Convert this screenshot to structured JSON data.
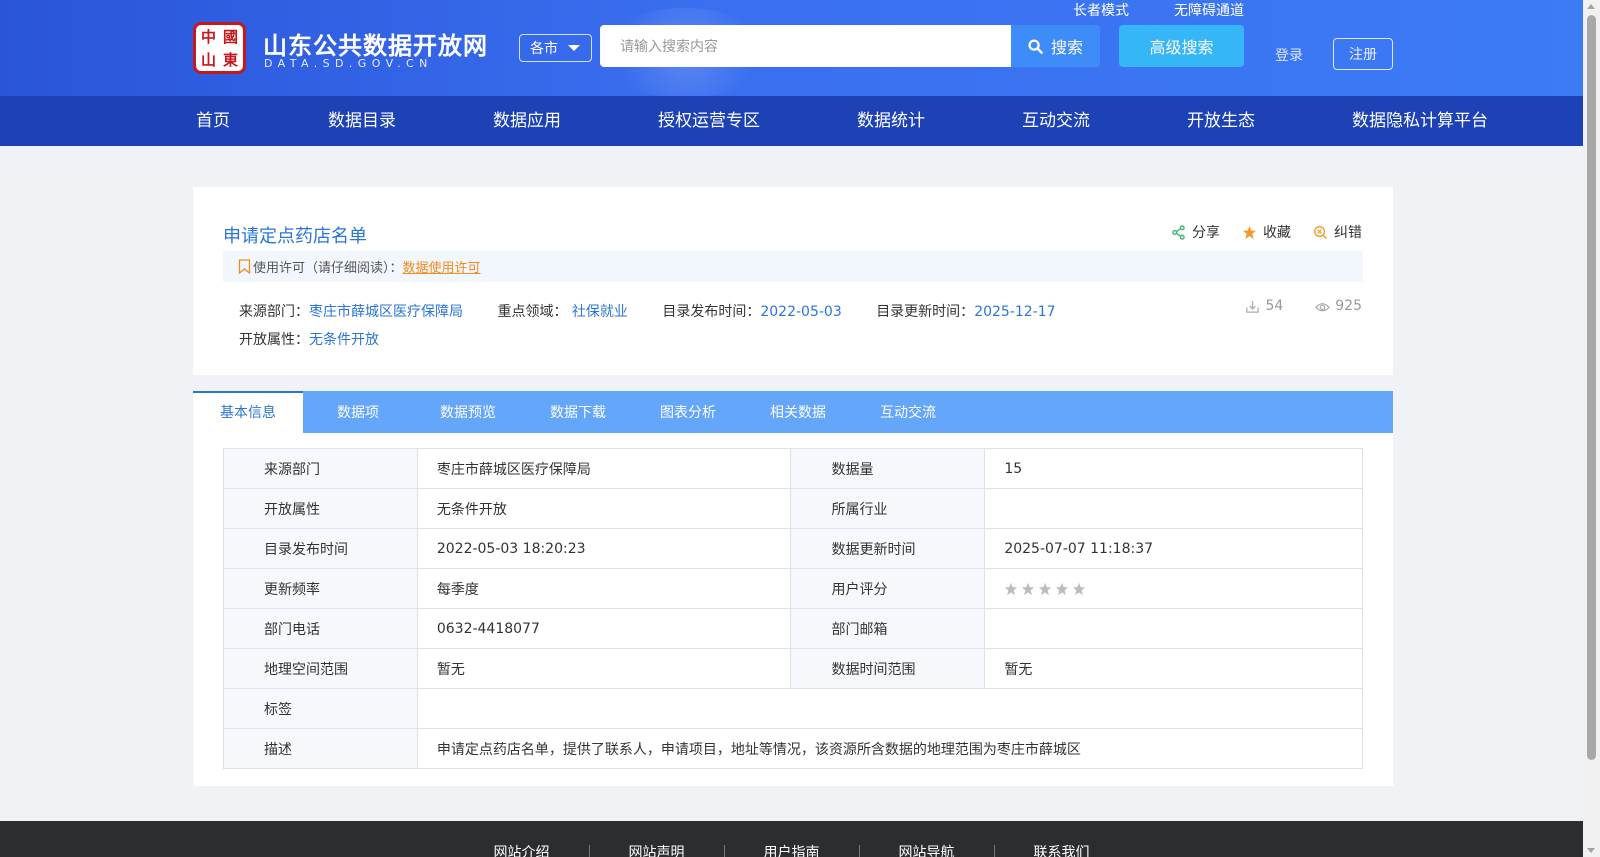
{
  "header": {
    "logo_chars": [
      "中",
      "國",
      "山",
      "東"
    ],
    "site_title": "山东公共数据开放网",
    "site_domain": "DATA.SD.GOV.CN",
    "city_select": "各市",
    "elder_mode": "长者模式",
    "accessibility": "无障碍通道",
    "search_placeholder": "请输入搜索内容",
    "search_label": "搜索",
    "advanced_search_label": "高级搜索",
    "login_label": "登录",
    "register_label": "注册"
  },
  "nav": {
    "items": [
      "首页",
      "数据目录",
      "数据应用",
      "授权运营专区",
      "数据统计",
      "互动交流",
      "开放生态",
      "数据隐私计算平台"
    ]
  },
  "dataset": {
    "title": "申请定点药店名单",
    "actions": {
      "share": "分享",
      "favorite": "收藏",
      "correct": "纠错"
    },
    "license_prefix": "使用许可（请仔细阅读）：",
    "license_link": "数据使用许可",
    "meta": {
      "source_label": "来源部门：",
      "source_value": "枣庄市薛城区医疗保障局",
      "domain_label": "重点领域：",
      "domain_value": "社保就业",
      "publish_label": "目录发布时间：",
      "publish_value": "2022-05-03",
      "update_label": "目录更新时间：",
      "update_value": "2025-12-17",
      "open_label": "开放属性：",
      "open_value": "无条件开放"
    },
    "downloads": "54",
    "views": "925"
  },
  "tabs": [
    "基本信息",
    "数据项",
    "数据预览",
    "数据下载",
    "图表分析",
    "相关数据",
    "互动交流"
  ],
  "active_tab": 0,
  "table": {
    "rows": [
      {
        "l1": "来源部门",
        "v1": "枣庄市薛城区医疗保障局",
        "l2": "数据量",
        "v2": "15"
      },
      {
        "l1": "开放属性",
        "v1": "无条件开放",
        "l2": "所属行业",
        "v2": ""
      },
      {
        "l1": "目录发布时间",
        "v1": "2022-05-03 18:20:23",
        "l2": "数据更新时间",
        "v2": "2025-07-07 11:18:37"
      },
      {
        "l1": "更新频率",
        "v1": "每季度",
        "l2": "用户评分",
        "v2": ""
      },
      {
        "l1": "部门电话",
        "v1": "0632-4418077",
        "l2": "部门邮箱",
        "v2": ""
      },
      {
        "l1": "地理空间范围",
        "v1": "暂无",
        "l2": "数据时间范围",
        "v2": "暂无"
      }
    ],
    "tag_label": "标签",
    "tag_value": "",
    "desc_label": "描述",
    "desc_value": "申请定点药店名单，提供了联系人，申请项目，地址等情况，该资源所含数据的地理范围为枣庄市薛城区",
    "rating": 0,
    "rating_max": 5
  },
  "footer": {
    "links": [
      "网站介绍",
      "网站声明",
      "用户指南",
      "网站导航",
      "联系我们"
    ]
  },
  "colors": {
    "nav_bg": "#1c42b5",
    "tab_bar": "#64a6f9",
    "link_blue": "#2a76d6",
    "license_orange": "#f08c1f"
  }
}
